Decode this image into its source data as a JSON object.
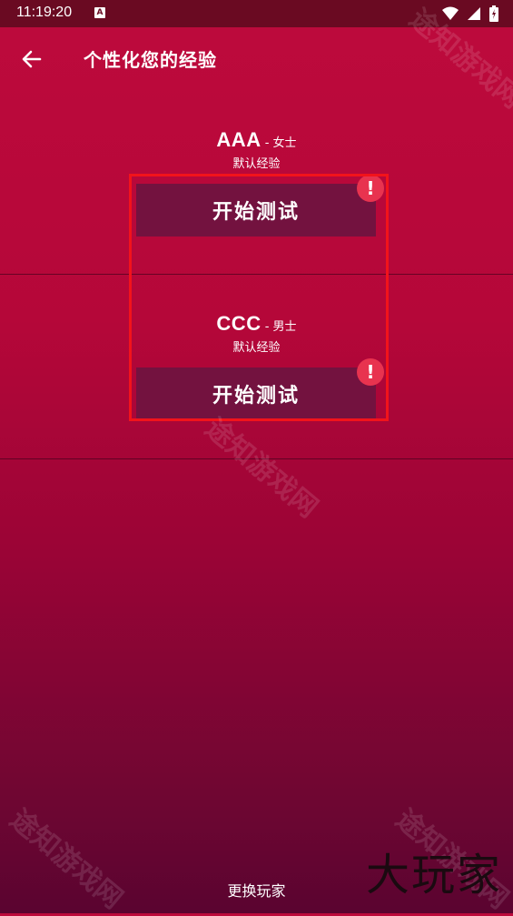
{
  "status_bar": {
    "time": "11:19:20",
    "notification_letter": "A"
  },
  "app_bar": {
    "title": "个性化您的经验"
  },
  "players": [
    {
      "name": "AAA",
      "gender": "- 女士",
      "experience": "默认经验",
      "button_label": "开始测试",
      "badge": "!"
    },
    {
      "name": "CCC",
      "gender": "- 男士",
      "experience": "默认经验",
      "button_label": "开始测试",
      "badge": "!"
    }
  ],
  "footer": {
    "switch_player_label": "更换玩家"
  },
  "watermarks": [
    "途知游戏网",
    "途知游戏网",
    "途知游戏网",
    "途知游戏网"
  ],
  "brand_logo": "大玩家",
  "colors": {
    "accent_red": "#f2131b",
    "button_bg": "#73123f",
    "badge": "#e8334f"
  }
}
